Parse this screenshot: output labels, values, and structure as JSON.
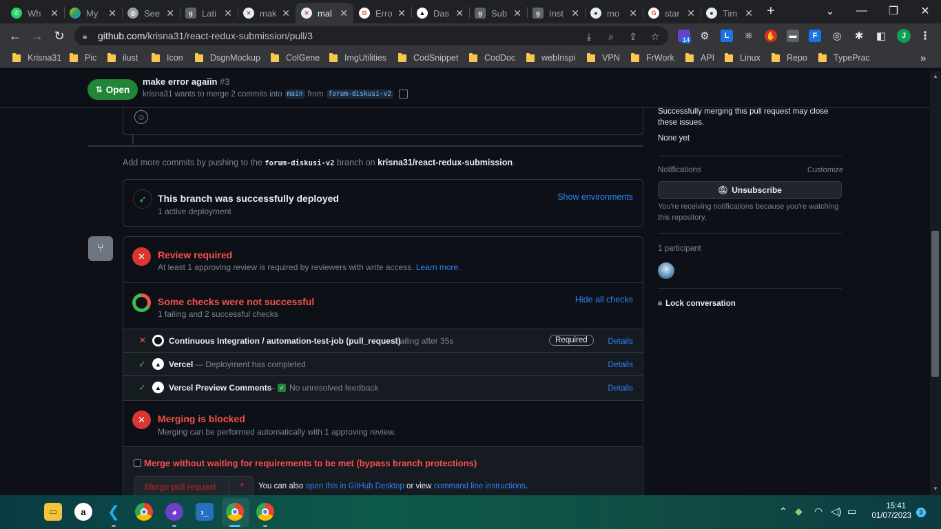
{
  "tabs": [
    {
      "title": "Wh",
      "icon": "whatsapp-icon",
      "color": "#25d366"
    },
    {
      "title": "My",
      "icon": "google-drive-icon",
      "color": "#1fa463"
    },
    {
      "title": "See",
      "icon": "globe-icon",
      "color": "#5f6368"
    },
    {
      "title": "Lati",
      "icon": "g-letter-icon",
      "color": "#5f6368"
    },
    {
      "title": "mak",
      "icon": "github-error-icon",
      "color": "#6e40c9"
    },
    {
      "title": "mal",
      "icon": "github-error-icon",
      "color": "#6e40c9"
    },
    {
      "title": "Erro",
      "icon": "google-icon",
      "color": "#ea4335"
    },
    {
      "title": "Das",
      "icon": "vercel-icon",
      "color": "#000000"
    },
    {
      "title": "Sub",
      "icon": "g-letter-icon",
      "color": "#5f6368"
    },
    {
      "title": "Inst",
      "icon": "g-letter-icon",
      "color": "#5f6368"
    },
    {
      "title": "mo",
      "icon": "github-icon",
      "color": "#24292f"
    },
    {
      "title": "star",
      "icon": "google-icon",
      "color": "#ea4335"
    },
    {
      "title": "Tim",
      "icon": "github-icon",
      "color": "#24292f"
    }
  ],
  "address": {
    "host": "github.com",
    "path": "/krisna31/react-redux-submission/pull/3"
  },
  "extensions": {
    "badge_count": "14",
    "avatar_letter": "J"
  },
  "bookmarks": [
    "Krisna31",
    "Pic",
    "ilust",
    "Icon",
    "DsgnMockup",
    "ColGene",
    "ImgUtilities",
    "CodSnippet",
    "CodDoc",
    "webInspi",
    "VPN",
    "FrWork",
    "API",
    "Linux",
    "Repo",
    "TypePrac"
  ],
  "pr": {
    "state": "Open",
    "title": "make error agaiin",
    "number": "#3",
    "author": "krisna31",
    "merge_text": "wants to merge 2 commits into",
    "base_branch": "main",
    "from_text": "from",
    "head_branch": "forum-diskusi-v2"
  },
  "push_hint": {
    "prefix": "Add more commits by pushing to the",
    "branch": "forum-diskusi-v2",
    "middle": "branch on",
    "repo": "krisna31/react-redux-submission",
    "suffix": "."
  },
  "deploy": {
    "title": "This branch was successfully deployed",
    "subtitle": "1 active deployment",
    "action": "Show environments"
  },
  "review": {
    "title": "Review required",
    "subtitle": "At least 1 approving review is required by reviewers with write access.",
    "learn_more": "Learn more."
  },
  "checks": {
    "title": "Some checks were not successful",
    "subtitle": "1 failing and 2 successful checks",
    "toggle": "Hide all checks",
    "items": [
      {
        "status": "fail",
        "name": "Continuous Integration / automation-test-job (pull_request)",
        "desc": "Failing after 35s",
        "required": "Required",
        "details": "Details"
      },
      {
        "status": "pass",
        "name": "Vercel",
        "desc": "— Deployment has completed",
        "details": "Details"
      },
      {
        "status": "pass",
        "name": "Vercel Preview Comments",
        "desc": "No unresolved feedback",
        "details": "Details"
      }
    ]
  },
  "merge": {
    "title": "Merging is blocked",
    "subtitle": "Merging can be performed automatically with 1 approving review.",
    "bypass_label": "Merge without waiting for requirements to be met (bypass branch protections)",
    "button": "Merge pull request",
    "also_prefix": "You can also",
    "desktop_link": "open this in GitHub Desktop",
    "or_view": "or view",
    "cli_link": "command line instructions",
    "suffix": "."
  },
  "sidebar": {
    "issues_note": "Successfully merging this pull request may close these issues.",
    "issues_value": "None yet",
    "notifications_label": "Notifications",
    "customize": "Customize",
    "unsubscribe": "Unsubscribe",
    "notify_reason": "You're receiving notifications because you're watching this repository.",
    "participants": "1 participant",
    "lock": "Lock conversation"
  },
  "taskbar": {
    "time": "15:41",
    "date": "01/07/2023",
    "notif_count": "3"
  },
  "colors": {
    "bg": "#0d1117",
    "border": "#30363d",
    "danger": "#f85149",
    "success": "#3fb950",
    "accent": "#2f81f7",
    "open_green": "#238636"
  }
}
